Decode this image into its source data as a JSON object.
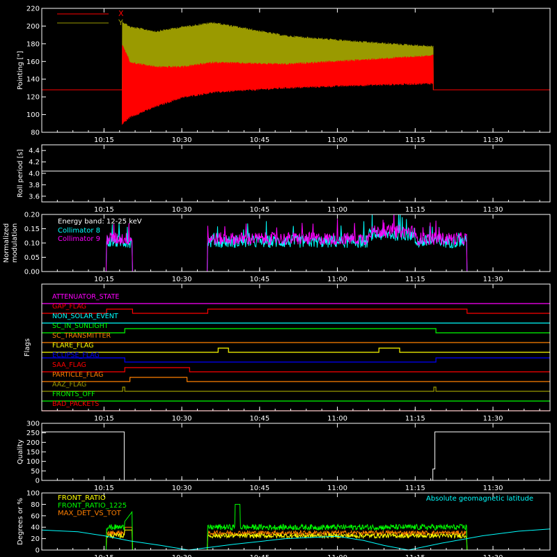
{
  "time_axis": {
    "tick_labels": [
      "10:15",
      "10:30",
      "10:45",
      "11:00",
      "11:15",
      "11:30"
    ],
    "tick_minutes": [
      615,
      630,
      645,
      660,
      675,
      690
    ],
    "range_minutes": [
      603,
      701
    ]
  },
  "colors": {
    "background": "#000000",
    "axes": "#ffffff",
    "red": "#ff0000",
    "olive": "#9a9a00",
    "cyan": "#00ffff",
    "magenta": "#ff00ff",
    "green": "#00ff00",
    "orange": "#ff7f00",
    "yellow": "#ffff00",
    "blue": "#0000ff"
  },
  "chart_data": [
    {
      "id": "pointing",
      "type": "line",
      "ylabel": "Pointing [\"]",
      "ylim": [
        80,
        220
      ],
      "yticks": [
        80,
        100,
        120,
        140,
        160,
        180,
        200,
        220
      ],
      "baseline": 128,
      "active_range": [
        618.5,
        678.5
      ],
      "legend_position": "top-left",
      "series": [
        {
          "name": "X",
          "color": "#ff0000",
          "envelope_min": [
            [
              618.5,
              88
            ],
            [
              620,
              96
            ],
            [
              625,
              108
            ],
            [
              630,
              118
            ],
            [
              636,
              124
            ],
            [
              650,
              129
            ],
            [
              665,
              132
            ],
            [
              678.5,
              134
            ]
          ],
          "envelope_max": [
            [
              618.5,
              180
            ],
            [
              620,
              160
            ],
            [
              625,
              155
            ],
            [
              630,
              155
            ],
            [
              636,
              160
            ],
            [
              650,
              158
            ],
            [
              665,
              163
            ],
            [
              678.5,
              168
            ]
          ]
        },
        {
          "name": "Y",
          "color": "#9a9a00",
          "envelope_min": [
            [
              618.5,
              112
            ],
            [
              620,
              125
            ],
            [
              625,
              135
            ],
            [
              630,
              140
            ],
            [
              636,
              142
            ],
            [
              650,
              140
            ],
            [
              665,
              138
            ],
            [
              678.5,
              138
            ]
          ],
          "envelope_max": [
            [
              618.5,
              206
            ],
            [
              620,
              200
            ],
            [
              625,
              195
            ],
            [
              630,
              200
            ],
            [
              636,
              205
            ],
            [
              650,
              190
            ],
            [
              665,
              183
            ],
            [
              678.5,
              178
            ]
          ]
        }
      ]
    },
    {
      "id": "roll",
      "type": "line",
      "ylabel": "Roll period [s]",
      "ylim": [
        3.5,
        4.5
      ],
      "yticks": [
        3.6,
        3.8,
        4.0,
        4.2,
        4.4
      ],
      "series": [
        {
          "name": "",
          "color": "#ffffff",
          "x": [
            603,
            701
          ],
          "y": [
            4.04,
            4.04
          ]
        }
      ]
    },
    {
      "id": "modulation",
      "type": "line",
      "ylabel": "Normalized modulation",
      "ylim": [
        0,
        0.2
      ],
      "yticks": [
        0.0,
        0.05,
        0.1,
        0.15,
        0.2
      ],
      "annotation": "Energy band: 12-25 keV",
      "active_intervals": [
        [
          615.5,
          620.5
        ],
        [
          635,
          685
        ]
      ],
      "series": [
        {
          "name": "Collimator 8",
          "color": "#00ffff",
          "level": 0.105
        },
        {
          "name": "Collimator 9",
          "color": "#ff00ff",
          "level": 0.115
        }
      ]
    },
    {
      "id": "flags",
      "type": "line",
      "ylabel": "Flags",
      "series": [
        {
          "name": "ATTENUATOR_STATE",
          "color": "#ff00ff",
          "steps": [
            [
              603,
              0
            ]
          ]
        },
        {
          "name": "GAP_FLAG",
          "color": "#ff0000",
          "steps": [
            [
              603,
              0
            ],
            [
              615.5,
              1
            ],
            [
              620.5,
              0
            ],
            [
              635,
              1
            ],
            [
              685,
              0
            ]
          ]
        },
        {
          "name": "NON_SOLAR_EVENT",
          "color": "#00ffff",
          "steps": [
            [
              603,
              0
            ]
          ]
        },
        {
          "name": "SC_IN_SUNLIGHT",
          "color": "#00ff00",
          "steps": [
            [
              603,
              0
            ],
            [
              619,
              1
            ],
            [
              679,
              0
            ]
          ]
        },
        {
          "name": "SC_TRANSMITTER",
          "color": "#ff7f00",
          "steps": [
            [
              603,
              0
            ]
          ]
        },
        {
          "name": "FLARE_FLAG",
          "color": "#ffff00",
          "steps": [
            [
              603,
              0
            ],
            [
              637,
              1
            ],
            [
              639,
              0
            ],
            [
              668,
              1
            ],
            [
              672,
              0
            ]
          ]
        },
        {
          "name": "ECLIPSE_FLAG",
          "color": "#0000ff",
          "steps": [
            [
              603,
              1
            ],
            [
              619,
              0
            ],
            [
              679,
              1
            ]
          ]
        },
        {
          "name": "SAA_FLAG",
          "color": "#ff0000",
          "steps": [
            [
              603,
              0
            ],
            [
              619,
              1
            ],
            [
              631.5,
              0
            ]
          ]
        },
        {
          "name": "PARTICLE_FLAG",
          "color": "#ff7f00",
          "steps": [
            [
              603,
              0
            ],
            [
              620,
              1
            ],
            [
              631,
              0
            ]
          ]
        },
        {
          "name": "AAZ_FLAG",
          "color": "#9a9a00",
          "steps": [
            [
              603,
              0
            ],
            [
              618.6,
              1
            ],
            [
              619,
              0
            ],
            [
              678.6,
              1
            ],
            [
              679,
              0
            ]
          ]
        },
        {
          "name": "FRONTS_OFF",
          "color": "#00ff00",
          "steps": [
            [
              603,
              0
            ]
          ]
        },
        {
          "name": "BAD_PACKETS",
          "color": "#ff0000",
          "steps": [
            [
              603,
              0
            ]
          ]
        }
      ]
    },
    {
      "id": "quality",
      "type": "line",
      "ylabel": "Quality",
      "ylim": [
        0,
        300
      ],
      "yticks": [
        0,
        50,
        100,
        150,
        200,
        250,
        300
      ],
      "series": [
        {
          "name": "",
          "color": "#ffffff",
          "x": [
            603,
            618.9,
            618.9,
            678.4,
            678.4,
            678.8,
            678.8,
            701
          ],
          "y": [
            255,
            255,
            0,
            0,
            60,
            60,
            255,
            255
          ]
        }
      ]
    },
    {
      "id": "ratios",
      "type": "line",
      "ylabel": "Degrees or %",
      "ylim": [
        0,
        100
      ],
      "yticks": [
        0,
        20,
        40,
        60,
        80,
        100
      ],
      "annotation": "Absolute geomagnetic latitude",
      "active_intervals": [
        [
          615.5,
          620.5
        ],
        [
          635,
          685
        ]
      ],
      "series": [
        {
          "name": "FRONT_RATIO",
          "color": "#ffff00",
          "level": 25
        },
        {
          "name": "FRONT_RATIO_1225",
          "color": "#00ff00",
          "level": 40
        },
        {
          "name": "MAX_DET_VS_TOT",
          "color": "#ff7f00",
          "level": 30
        },
        {
          "name": "Absolute geomagnetic latitude",
          "color": "#00ffff",
          "x": [
            603,
            610,
            615,
            620,
            626,
            631.3,
            640,
            650,
            660,
            665,
            669,
            673.7,
            680,
            688,
            695,
            701
          ],
          "y": [
            35,
            32,
            25,
            16,
            8,
            0,
            10,
            20,
            24,
            17,
            8,
            0,
            12,
            25,
            33,
            37
          ]
        }
      ]
    }
  ]
}
